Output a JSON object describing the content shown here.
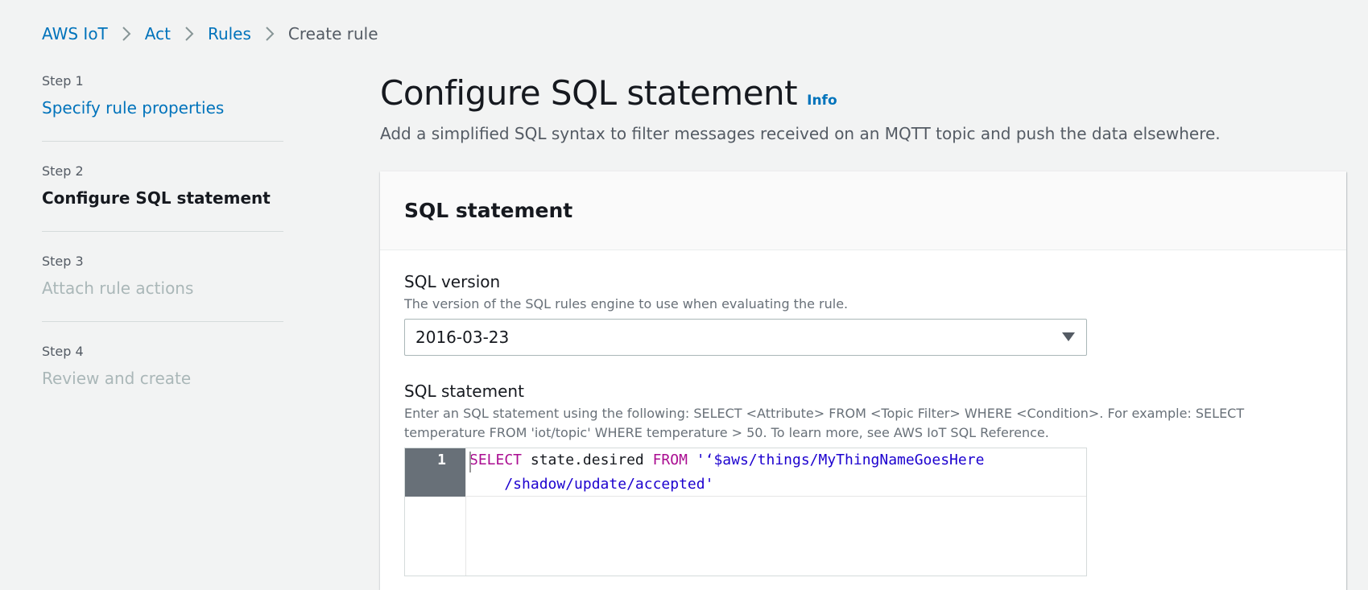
{
  "breadcrumb": {
    "items": [
      "AWS IoT",
      "Act",
      "Rules"
    ],
    "current": "Create rule"
  },
  "steps": [
    {
      "number": "Step 1",
      "title": "Specify rule properties",
      "state": "link"
    },
    {
      "number": "Step 2",
      "title": "Configure SQL statement",
      "state": "current"
    },
    {
      "number": "Step 3",
      "title": "Attach rule actions",
      "state": "disabled"
    },
    {
      "number": "Step 4",
      "title": "Review and create",
      "state": "disabled"
    }
  ],
  "page": {
    "title": "Configure SQL statement",
    "info_label": "Info",
    "description": "Add a simplified SQL syntax to filter messages received on an MQTT topic and push the data elsewhere."
  },
  "panel": {
    "title": "SQL statement",
    "sql_version": {
      "label": "SQL version",
      "description": "The version of the SQL rules engine to use when evaluating the rule.",
      "value": "2016-03-23"
    },
    "sql_statement": {
      "label": "SQL statement",
      "description": "Enter an SQL statement using the following: SELECT <Attribute> FROM <Topic Filter> WHERE <Condition>. For example: SELECT temperature FROM 'iot/topic' WHERE temperature > 50. To learn more, see AWS IoT SQL Reference.",
      "line_number": "1",
      "code": {
        "kw_select": "SELECT",
        "attr": " state.desired ",
        "kw_from": "FROM",
        "topic_line1": " '‘$aws/things/MyThingNameGoesHere",
        "topic_line2": "    /shadow/update/accepted'"
      }
    }
  },
  "colors": {
    "link": "#0073bb",
    "background": "#f2f3f3",
    "keyword": "#aa0d91",
    "string": "#1c00cf",
    "gutter_active": "#687078"
  },
  "icons": {
    "breadcrumb_separator": "chevron-right-icon",
    "select_caret": "caret-down-icon"
  }
}
